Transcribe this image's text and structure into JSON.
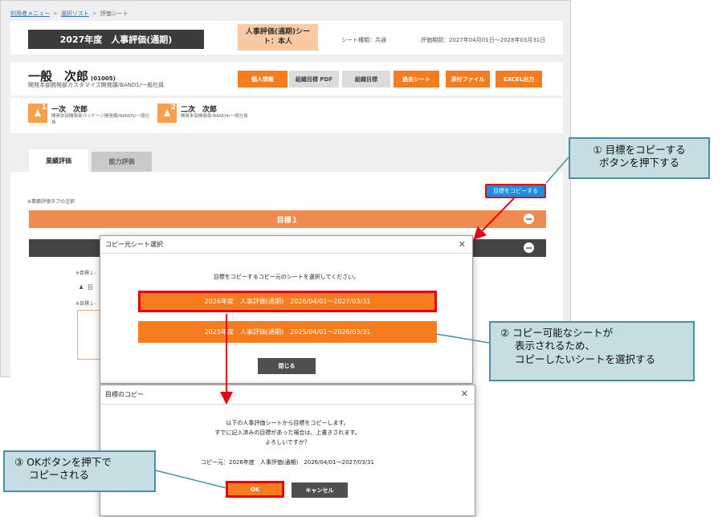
{
  "breadcrumb": {
    "item1": "利用者メニュー",
    "item2": "選択リスト",
    "item3": "評価シート",
    "sep": ">"
  },
  "sheet": {
    "title": "2027年度　人事評価(通期)",
    "type_label": "人事評価(通期)シート：本人",
    "type_meta": "シート種類：共通",
    "period_meta": "評価期間：2027年04月01日～2028年03月31日"
  },
  "user": {
    "name": "一般　次郎",
    "id": "(01005)",
    "dept": "開発本部開発部カスタマイズ開発課/BAND1/一般社員"
  },
  "actions": {
    "personal_info": "個人情報",
    "org_goal_pdf": "組織目標 PDF",
    "org_goal": "組織目標",
    "past_sheet": "過去シート",
    "attachments": "添付ファイル",
    "excel_output": "EXCEL出力"
  },
  "evaluators": [
    {
      "level": "1",
      "name": "一次　次郎",
      "dept": "開発本部開発部パッケージ開発課/BAND5/一般社員"
    },
    {
      "level": "2",
      "name": "二次　次郎",
      "dept": "開発本部開発部/BAND4/一般社員"
    }
  ],
  "tabs": {
    "performance": "業績評価",
    "ability": "能力評価"
  },
  "main": {
    "tab_note": "※業績評価タブの注釈",
    "copy_goal_button": "目標をコピーする",
    "goal_header": "目標１",
    "goal_note_1": "※目標１-",
    "goal_note_2": "※目標１-",
    "goal_item": "目"
  },
  "copy_source_modal": {
    "title": "コピー元シート選択",
    "message": "目標をコピーするコピー元のシートを選択してください。",
    "options": [
      "2026年度　人事評価(通期)　2026/04/01～2027/03/31",
      "2025年度　人事評価(通期)　2025/04/01～2026/03/31"
    ],
    "close_button": "閉じる"
  },
  "copy_confirm_modal": {
    "title": "目標のコピー",
    "line1": "以下の人事評価シートから目標をコピーします。",
    "line2": "すでに記入済みの目標があった場合は、上書きされます。",
    "line3": "よろしいですか？",
    "source": "コピー元：2026年度　人事評価(通期)　2026/04/01～2027/03/31",
    "ok_button": "OK",
    "cancel_button": "キャンセル"
  },
  "callouts": {
    "step1_line1": "① 目標をコピーする",
    "step1_line2": "ボタンを押下する",
    "step2_line1": "② コピー可能なシートが",
    "step2_line2": "表示されるため、",
    "step2_line3": "コピーしたいシートを選択する",
    "step3_line1": "③ OKボタンを押下で",
    "step3_line2": "コピーされる"
  },
  "colors": {
    "orange": "#f57c1f",
    "highlight_red": "#e60012",
    "callout_fill": "#c5dde3",
    "callout_border": "#4a8fa0",
    "blue_button": "#1b8ee0"
  }
}
